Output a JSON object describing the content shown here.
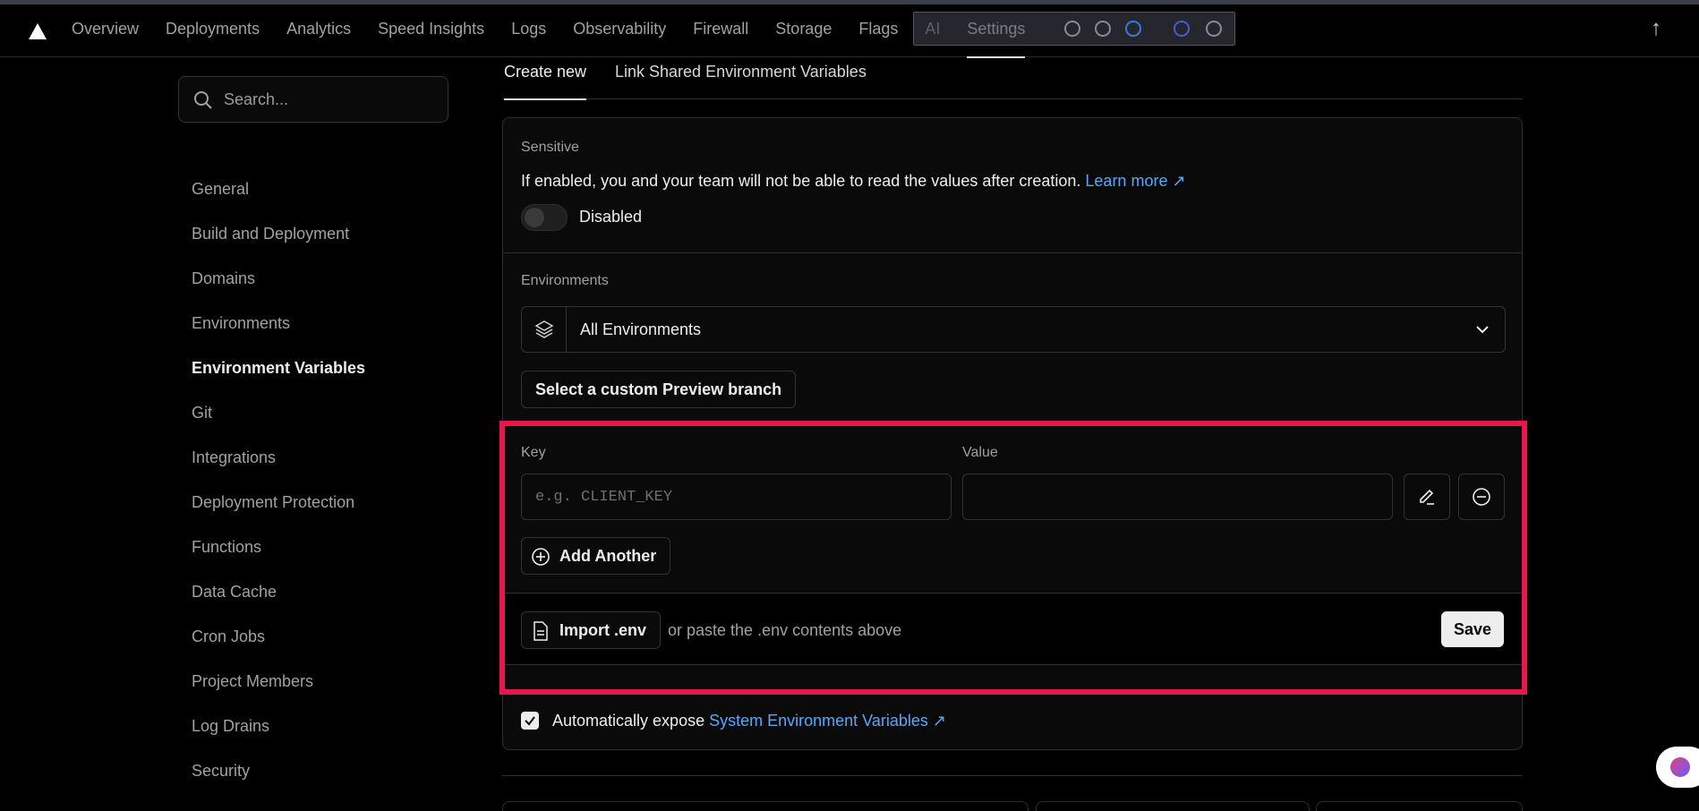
{
  "nav": {
    "items": [
      "Overview",
      "Deployments",
      "Analytics",
      "Speed Insights",
      "Logs",
      "Observability",
      "Firewall",
      "Storage",
      "Flags",
      "AI",
      "Settings"
    ],
    "active": "Settings"
  },
  "sidebar": {
    "search_placeholder": "Search...",
    "items": [
      "General",
      "Build and Deployment",
      "Domains",
      "Environments",
      "Environment Variables",
      "Git",
      "Integrations",
      "Deployment Protection",
      "Functions",
      "Data Cache",
      "Cron Jobs",
      "Project Members",
      "Log Drains",
      "Security"
    ],
    "active": "Environment Variables"
  },
  "tabs": [
    "Create new",
    "Link Shared Environment Variables"
  ],
  "sensitive": {
    "label": "Sensitive",
    "description": "If enabled, you and your team will not be able to read the values after creation.",
    "learn_more": "Learn more",
    "toggle_state": "Disabled"
  },
  "environments": {
    "label": "Environments",
    "selected": "All Environments",
    "preview_branch_button": "Select a custom Preview branch"
  },
  "variable": {
    "key_label": "Key",
    "value_label": "Value",
    "key_placeholder": "e.g. CLIENT_KEY",
    "value": "",
    "add_another": "Add Another"
  },
  "import": {
    "button": "Import .env",
    "hint": "or paste the .env contents above",
    "save": "Save"
  },
  "expose": {
    "checked": true,
    "text": "Automatically expose",
    "link": "System Environment Variables"
  },
  "colors": {
    "accent_link": "#52a8ff",
    "highlight": "#e8184e"
  }
}
